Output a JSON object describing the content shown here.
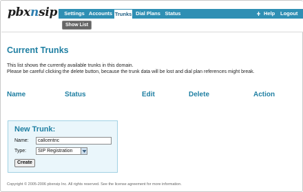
{
  "logo": {
    "part1": "pbx",
    "part2": "n",
    "part3": "sip"
  },
  "nav": {
    "items": [
      "Settings",
      "Accounts",
      "Trunks",
      "Dial Plans",
      "Status"
    ],
    "active": "Trunks",
    "help": "Help",
    "logout": "Logout",
    "help_icon": "plus-icon"
  },
  "subnav": {
    "show_list": "Show List"
  },
  "main": {
    "title": "Current Trunks",
    "desc1": "This list shows the currently available trunks in this domain.",
    "desc2": "Please be careful clicking the delete button, because the trunk data will be lost and dial plan references might break.",
    "columns": [
      "Name",
      "Status",
      "Edit",
      "Delete",
      "Action"
    ]
  },
  "new_trunk": {
    "title": "New Trunk:",
    "name_label": "Name:",
    "name_value": "callcentric",
    "type_label": "Type:",
    "type_value": "SIP Registration",
    "create_label": "Create"
  },
  "footer": "Copyright © 2005-2006 pbxnsip Inc. All rights reserved. See the license agreement for more information.",
  "colors": {
    "accent": "#2f8fb4",
    "heading": "#1f7fa2",
    "box_bg": "#eaf6fb"
  }
}
